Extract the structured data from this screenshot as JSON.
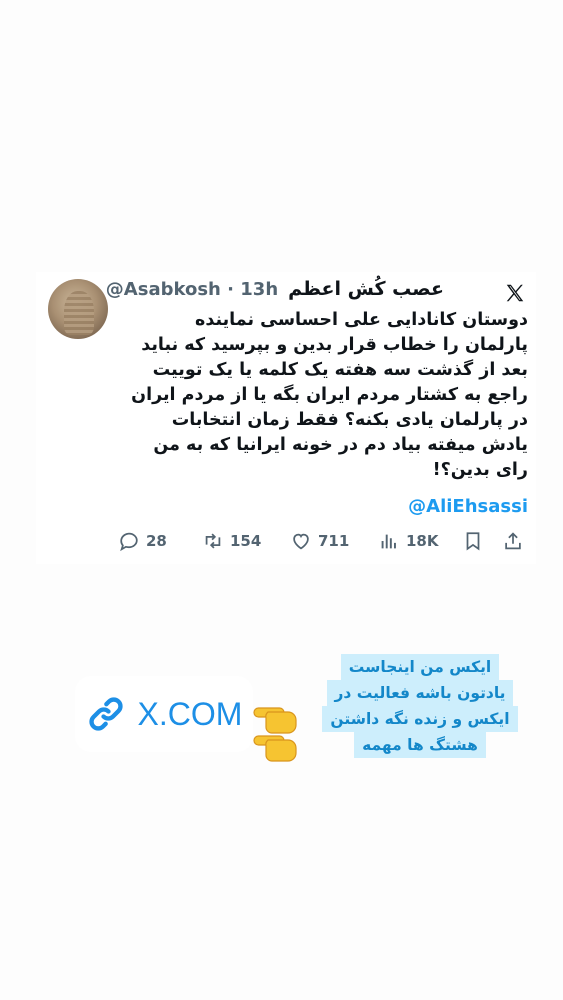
{
  "tweet": {
    "display_name": "عصب کُش اعظم",
    "handle": "@Asabkosh",
    "separator": "·",
    "time": "13h",
    "lines": [
      "دوستان کانادایی علی احساسی نماینده",
      "پارلمان را خطاب قرار بدین و بپرسید که نباید",
      "بعد از گذشت سه هفته یک کلمه یا یک توییت",
      "راجع به کشتار مردم ایران بگه یا از مردم ایران",
      "در پارلمان یادی بکنه؟ فقط زمان انتخابات",
      "یادش میفته بیاد دم در خونه ایرانیا که به من",
      "رای بدین؟!"
    ],
    "mention": "@AliEhsassi",
    "stats": {
      "replies": "28",
      "retweets": "154",
      "likes": "711",
      "views": "18K"
    },
    "icons": [
      "x-logo-icon",
      "reply-icon",
      "retweet-icon",
      "like-icon",
      "views-icon",
      "bookmark-icon",
      "share-icon"
    ]
  },
  "link_badge": {
    "text": "X.COM",
    "icon": "link-icon",
    "color": "#1d8fe6"
  },
  "note": {
    "lines": [
      "ایکس من اینجاست",
      "یادتون باشه فعالیت در",
      "ایکس و زنده نگه داشتن",
      "هشتگ ها مهمه"
    ],
    "background": "#cdeefc",
    "color": "#1387c9"
  },
  "emoji": "pointing-hands-emoji"
}
